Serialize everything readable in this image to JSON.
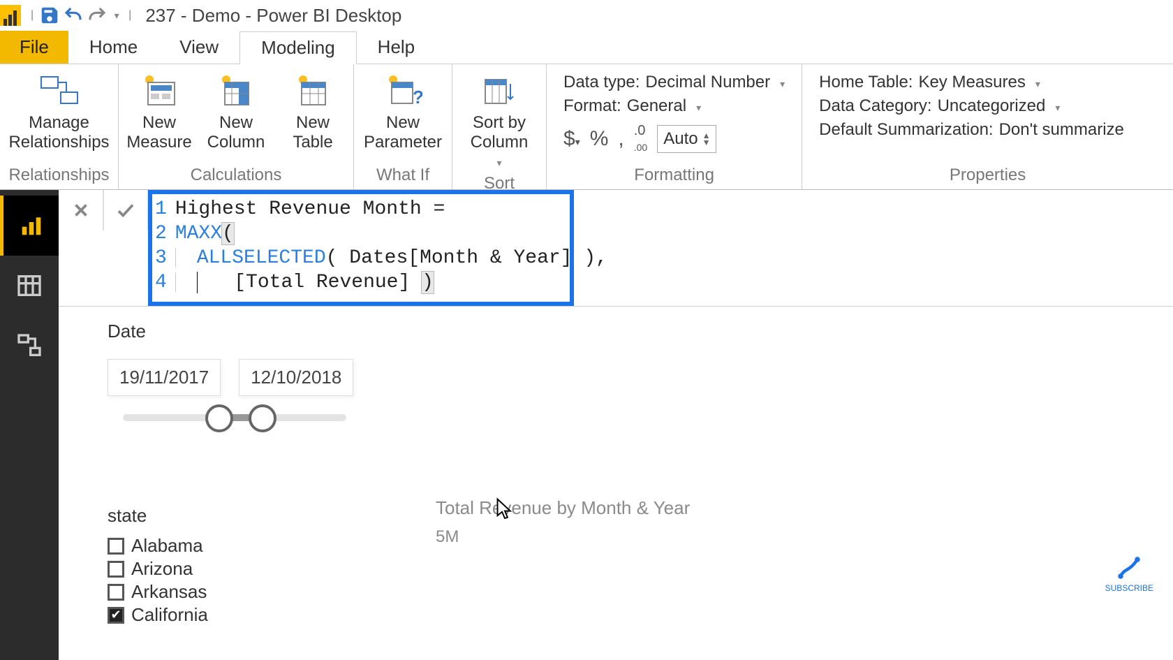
{
  "app": {
    "title": "237 - Demo - Power BI Desktop"
  },
  "ribbon": {
    "tabs": {
      "file": "File",
      "home": "Home",
      "view": "View",
      "modeling": "Modeling",
      "help": "Help"
    },
    "groups": {
      "relationships": {
        "label": "Relationships",
        "manage": "Manage\nRelationships"
      },
      "calculations": {
        "label": "Calculations",
        "new_measure": "New\nMeasure",
        "new_column": "New\nColumn",
        "new_table": "New\nTable"
      },
      "whatif": {
        "label": "What If",
        "new_parameter": "New\nParameter"
      },
      "sort": {
        "label": "Sort",
        "sort_by_column": "Sort by\nColumn"
      },
      "formatting": {
        "label": "Formatting",
        "data_type_label": "Data type:",
        "data_type_value": "Decimal Number",
        "format_label": "Format:",
        "format_value": "General",
        "auto": "Auto"
      },
      "properties": {
        "label": "Properties",
        "home_table_label": "Home Table:",
        "home_table_value": "Key Measures",
        "data_category_label": "Data Category:",
        "data_category_value": "Uncategorized",
        "default_summarization_label": "Default Summarization:",
        "default_summarization_value": "Don't summarize"
      }
    }
  },
  "formula": {
    "lines": [
      "Highest Revenue Month =",
      "MAXX(",
      "    ALLSELECTED( Dates[Month & Year] ),",
      "        [Total Revenue] )"
    ]
  },
  "slicer": {
    "date_label": "Date",
    "start": "19/11/2017",
    "end": "12/10/2018"
  },
  "state_slicer": {
    "label": "state",
    "items": [
      {
        "name": "Alabama",
        "checked": false
      },
      {
        "name": "Arizona",
        "checked": false
      },
      {
        "name": "Arkansas",
        "checked": false
      },
      {
        "name": "California",
        "checked": true
      }
    ]
  },
  "chart": {
    "title": "Total Revenue by Month & Year",
    "y_tick_top": "5M"
  },
  "subscribe": "SUBSCRIBE"
}
